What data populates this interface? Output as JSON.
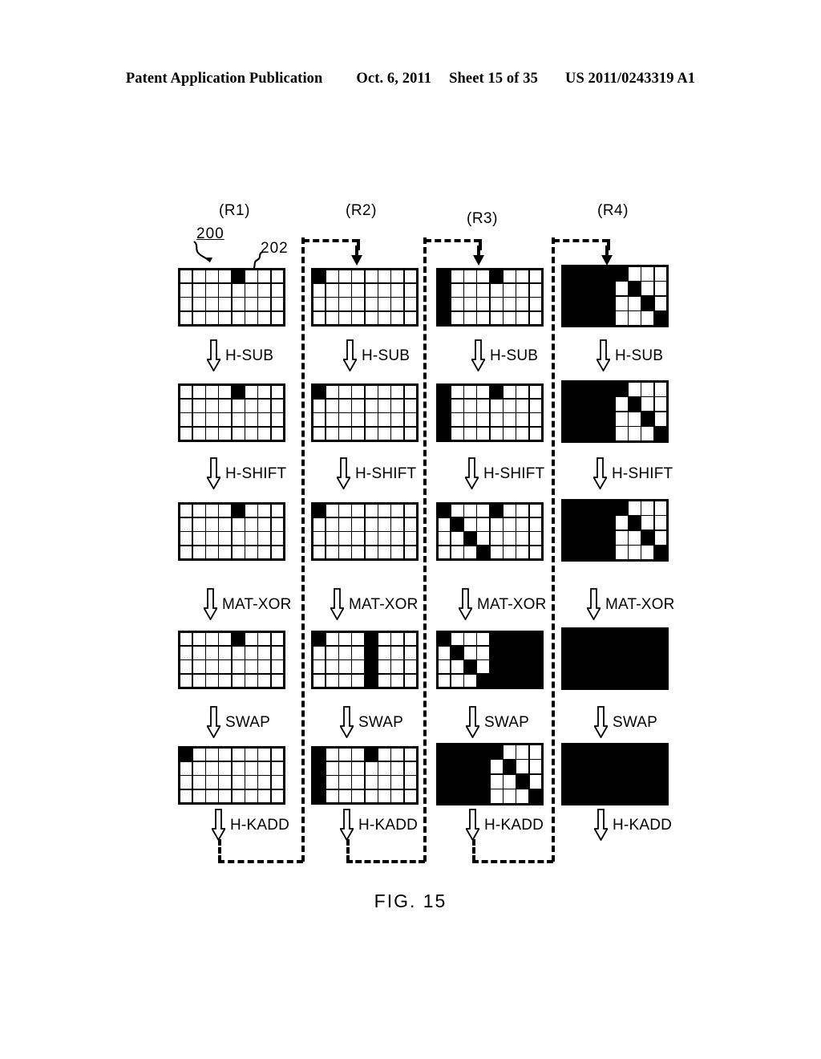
{
  "header": {
    "publication": "Patent Application Publication",
    "date": "Oct. 6, 2011",
    "sheet": "Sheet 15 of 35",
    "patent_number": "US 2011/0243319 A1"
  },
  "figure": {
    "caption": "FIG. 15",
    "reference_numerals": [
      {
        "id": "200",
        "label": "200"
      },
      {
        "id": "202",
        "label": "202"
      }
    ],
    "round_labels": [
      "(R1)",
      "(R2)",
      "(R3)",
      "(R4)"
    ],
    "operations": [
      "H-SUB",
      "H-SHIFT",
      "MAT-XOR",
      "SWAP",
      "H-KADD"
    ],
    "matrix": {
      "rows": 4,
      "cols": 8
    },
    "colors": {
      "cell_on": "#000000",
      "cell_off": "#ffffff",
      "grid_line": "#000000"
    },
    "stages": [
      {
        "round": "(R1)",
        "states": [
          {
            "stage": "input",
            "on": [
              [
                0,
                4
              ]
            ]
          },
          {
            "stage": "H-SUB",
            "on": [
              [
                0,
                4
              ]
            ]
          },
          {
            "stage": "H-SHIFT",
            "on": [
              [
                0,
                4
              ]
            ]
          },
          {
            "stage": "MAT-XOR",
            "on": [
              [
                0,
                4
              ]
            ]
          },
          {
            "stage": "SWAP",
            "on": [
              [
                0,
                0
              ]
            ]
          }
        ]
      },
      {
        "round": "(R2)",
        "states": [
          {
            "stage": "input",
            "on": [
              [
                0,
                0
              ]
            ]
          },
          {
            "stage": "H-SUB",
            "on": [
              [
                0,
                0
              ]
            ]
          },
          {
            "stage": "H-SHIFT",
            "on": [
              [
                0,
                0
              ]
            ]
          },
          {
            "stage": "MAT-XOR",
            "on": [
              [
                0,
                0
              ],
              [
                0,
                4
              ],
              [
                1,
                4
              ],
              [
                2,
                4
              ],
              [
                3,
                4
              ]
            ]
          },
          {
            "stage": "SWAP",
            "on": [
              [
                0,
                0
              ],
              [
                1,
                0
              ],
              [
                2,
                0
              ],
              [
                3,
                0
              ],
              [
                0,
                4
              ]
            ]
          }
        ]
      },
      {
        "round": "(R3)",
        "states": [
          {
            "stage": "input",
            "on": [
              [
                0,
                0
              ],
              [
                1,
                0
              ],
              [
                2,
                0
              ],
              [
                3,
                0
              ],
              [
                0,
                4
              ]
            ]
          },
          {
            "stage": "H-SUB",
            "on": [
              [
                0,
                0
              ],
              [
                1,
                0
              ],
              [
                2,
                0
              ],
              [
                3,
                0
              ],
              [
                0,
                4
              ]
            ]
          },
          {
            "stage": "H-SHIFT",
            "on": [
              [
                0,
                0
              ],
              [
                1,
                1
              ],
              [
                2,
                2
              ],
              [
                3,
                3
              ],
              [
                0,
                4
              ]
            ]
          },
          {
            "stage": "MAT-XOR",
            "on": [
              [
                0,
                0
              ],
              [
                1,
                1
              ],
              [
                2,
                2
              ],
              [
                3,
                3
              ],
              [
                0,
                4
              ],
              [
                0,
                5
              ],
              [
                0,
                6
              ],
              [
                0,
                7
              ],
              [
                1,
                4
              ],
              [
                1,
                5
              ],
              [
                1,
                6
              ],
              [
                1,
                7
              ],
              [
                2,
                4
              ],
              [
                2,
                5
              ],
              [
                2,
                6
              ],
              [
                2,
                7
              ],
              [
                3,
                4
              ],
              [
                3,
                5
              ],
              [
                3,
                6
              ],
              [
                3,
                7
              ]
            ]
          },
          {
            "stage": "SWAP",
            "on": [
              [
                0,
                0
              ],
              [
                0,
                1
              ],
              [
                0,
                2
              ],
              [
                0,
                3
              ],
              [
                1,
                0
              ],
              [
                1,
                1
              ],
              [
                1,
                2
              ],
              [
                1,
                3
              ],
              [
                2,
                0
              ],
              [
                2,
                1
              ],
              [
                2,
                2
              ],
              [
                2,
                3
              ],
              [
                3,
                0
              ],
              [
                3,
                1
              ],
              [
                3,
                2
              ],
              [
                3,
                3
              ],
              [
                0,
                4
              ],
              [
                1,
                5
              ],
              [
                2,
                6
              ],
              [
                3,
                7
              ]
            ]
          }
        ]
      },
      {
        "round": "(R4)",
        "states": [
          {
            "stage": "input",
            "on": [
              [
                0,
                0
              ],
              [
                0,
                1
              ],
              [
                0,
                2
              ],
              [
                0,
                3
              ],
              [
                1,
                0
              ],
              [
                1,
                1
              ],
              [
                1,
                2
              ],
              [
                1,
                3
              ],
              [
                2,
                0
              ],
              [
                2,
                1
              ],
              [
                2,
                2
              ],
              [
                2,
                3
              ],
              [
                3,
                0
              ],
              [
                3,
                1
              ],
              [
                3,
                2
              ],
              [
                3,
                3
              ],
              [
                0,
                4
              ],
              [
                1,
                5
              ],
              [
                2,
                6
              ],
              [
                3,
                7
              ]
            ]
          },
          {
            "stage": "H-SUB",
            "on": [
              [
                0,
                0
              ],
              [
                0,
                1
              ],
              [
                0,
                2
              ],
              [
                0,
                3
              ],
              [
                1,
                0
              ],
              [
                1,
                1
              ],
              [
                1,
                2
              ],
              [
                1,
                3
              ],
              [
                2,
                0
              ],
              [
                2,
                1
              ],
              [
                2,
                2
              ],
              [
                2,
                3
              ],
              [
                3,
                0
              ],
              [
                3,
                1
              ],
              [
                3,
                2
              ],
              [
                3,
                3
              ],
              [
                0,
                4
              ],
              [
                1,
                5
              ],
              [
                2,
                6
              ],
              [
                3,
                7
              ]
            ]
          },
          {
            "stage": "H-SHIFT",
            "on": [
              [
                0,
                0
              ],
              [
                0,
                1
              ],
              [
                0,
                2
              ],
              [
                0,
                3
              ],
              [
                1,
                0
              ],
              [
                1,
                1
              ],
              [
                1,
                2
              ],
              [
                1,
                3
              ],
              [
                2,
                0
              ],
              [
                2,
                1
              ],
              [
                2,
                2
              ],
              [
                2,
                3
              ],
              [
                3,
                0
              ],
              [
                3,
                1
              ],
              [
                3,
                2
              ],
              [
                3,
                3
              ],
              [
                0,
                4
              ],
              [
                1,
                5
              ],
              [
                2,
                6
              ],
              [
                3,
                7
              ]
            ]
          },
          {
            "stage": "MAT-XOR",
            "all_on": true,
            "on": []
          },
          {
            "stage": "SWAP",
            "all_on": true,
            "on": []
          }
        ]
      }
    ]
  }
}
